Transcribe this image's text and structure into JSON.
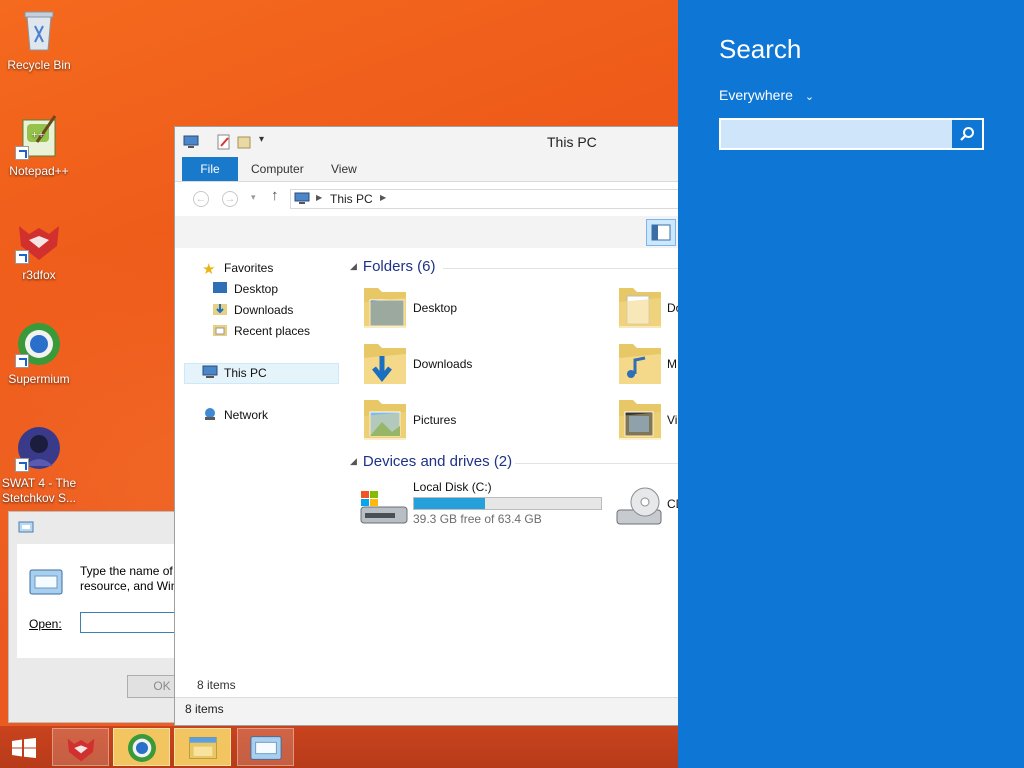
{
  "desktop": {
    "icons": [
      {
        "label": "Recycle Bin"
      },
      {
        "label": "Notepad++"
      },
      {
        "label": "r3dfox"
      },
      {
        "label": "Supermium"
      },
      {
        "label": "SWAT 4 - The Stetchkov S..."
      }
    ]
  },
  "run_dialog": {
    "description_line1": "Type the name of",
    "description_line2": "resource, and Win",
    "open_label": "Open:",
    "open_value": "",
    "ok_label": "OK"
  },
  "explorer": {
    "title": "This PC",
    "ribbon_tabs": [
      "File",
      "Computer",
      "View"
    ],
    "address_path": "This PC",
    "nav": {
      "favorites": "Favorites",
      "desktop": "Desktop",
      "downloads": "Downloads",
      "recent": "Recent places",
      "this_pc": "This PC",
      "network": "Network"
    },
    "folders_header": "Folders (6)",
    "folders": [
      {
        "label": "Desktop"
      },
      {
        "label": "Do"
      },
      {
        "label": "Downloads"
      },
      {
        "label": "M"
      },
      {
        "label": "Pictures"
      },
      {
        "label": "Vi"
      }
    ],
    "drives_header": "Devices and drives (2)",
    "drive_c": {
      "label": "Local Disk (C:)",
      "free_text": "39.3 GB free of 63.4 GB",
      "used_fraction": 0.38
    },
    "drive_cd": {
      "label": "CD"
    },
    "items_count": "8 items",
    "statusbar_count": "8 items"
  },
  "search_charm": {
    "title": "Search",
    "scope": "Everywhere",
    "input_value": "",
    "accent": "#0e76d4"
  },
  "taskbar": {
    "items": [
      "start-button",
      "r3dfox",
      "supermium",
      "file-explorer",
      "run"
    ]
  }
}
